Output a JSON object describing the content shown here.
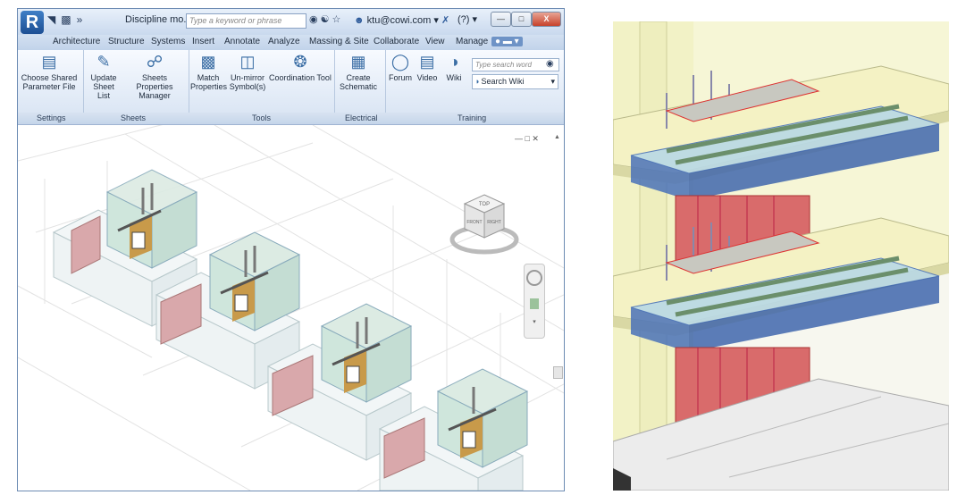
{
  "window": {
    "app_button": "R",
    "title": "Discipline mo...",
    "search_placeholder": "Type a keyword or phrase",
    "user": "ktu@cowi.com",
    "help": "?"
  },
  "tabs": [
    "Architecture",
    "Structure",
    "Systems",
    "Insert",
    "Annotate",
    "Analyze",
    "Massing & Site",
    "Collaborate",
    "View",
    "Manage"
  ],
  "ribbon": {
    "settings": {
      "choose_shared": "Choose Shared",
      "parameter_file": "Parameter File"
    },
    "sheets": {
      "update": "Update",
      "sheet_list": "Sheet List",
      "sheets_properties": "Sheets Properties",
      "manager": "Manager"
    },
    "tools": {
      "match": "Match",
      "properties": "Properties",
      "unmirror": "Un-mirror",
      "symbols": "Symbol(s)",
      "coordination_tool": "Coordination Tool"
    },
    "electrical": {
      "create": "Create",
      "schematic": "Schematic"
    },
    "training": {
      "forum": "Forum",
      "video": "Video",
      "wiki": "Wiki",
      "search_word_placeholder": "Type search word",
      "search_wiki": "Search Wiki"
    }
  },
  "panels": [
    "Settings",
    "Sheets",
    "Tools",
    "Electrical",
    "Training"
  ],
  "viewcube": {
    "top": "TOP",
    "front": "FRONT",
    "right": "RIGHT"
  },
  "colors": {
    "accent": "#3b6ea5",
    "pink_wall": "#d9a8ab",
    "glass": "#cfe6dc",
    "floor_yellow": "#f4f2c4",
    "tray_blue": "#4a72b8",
    "red_column": "#d96b6b"
  }
}
